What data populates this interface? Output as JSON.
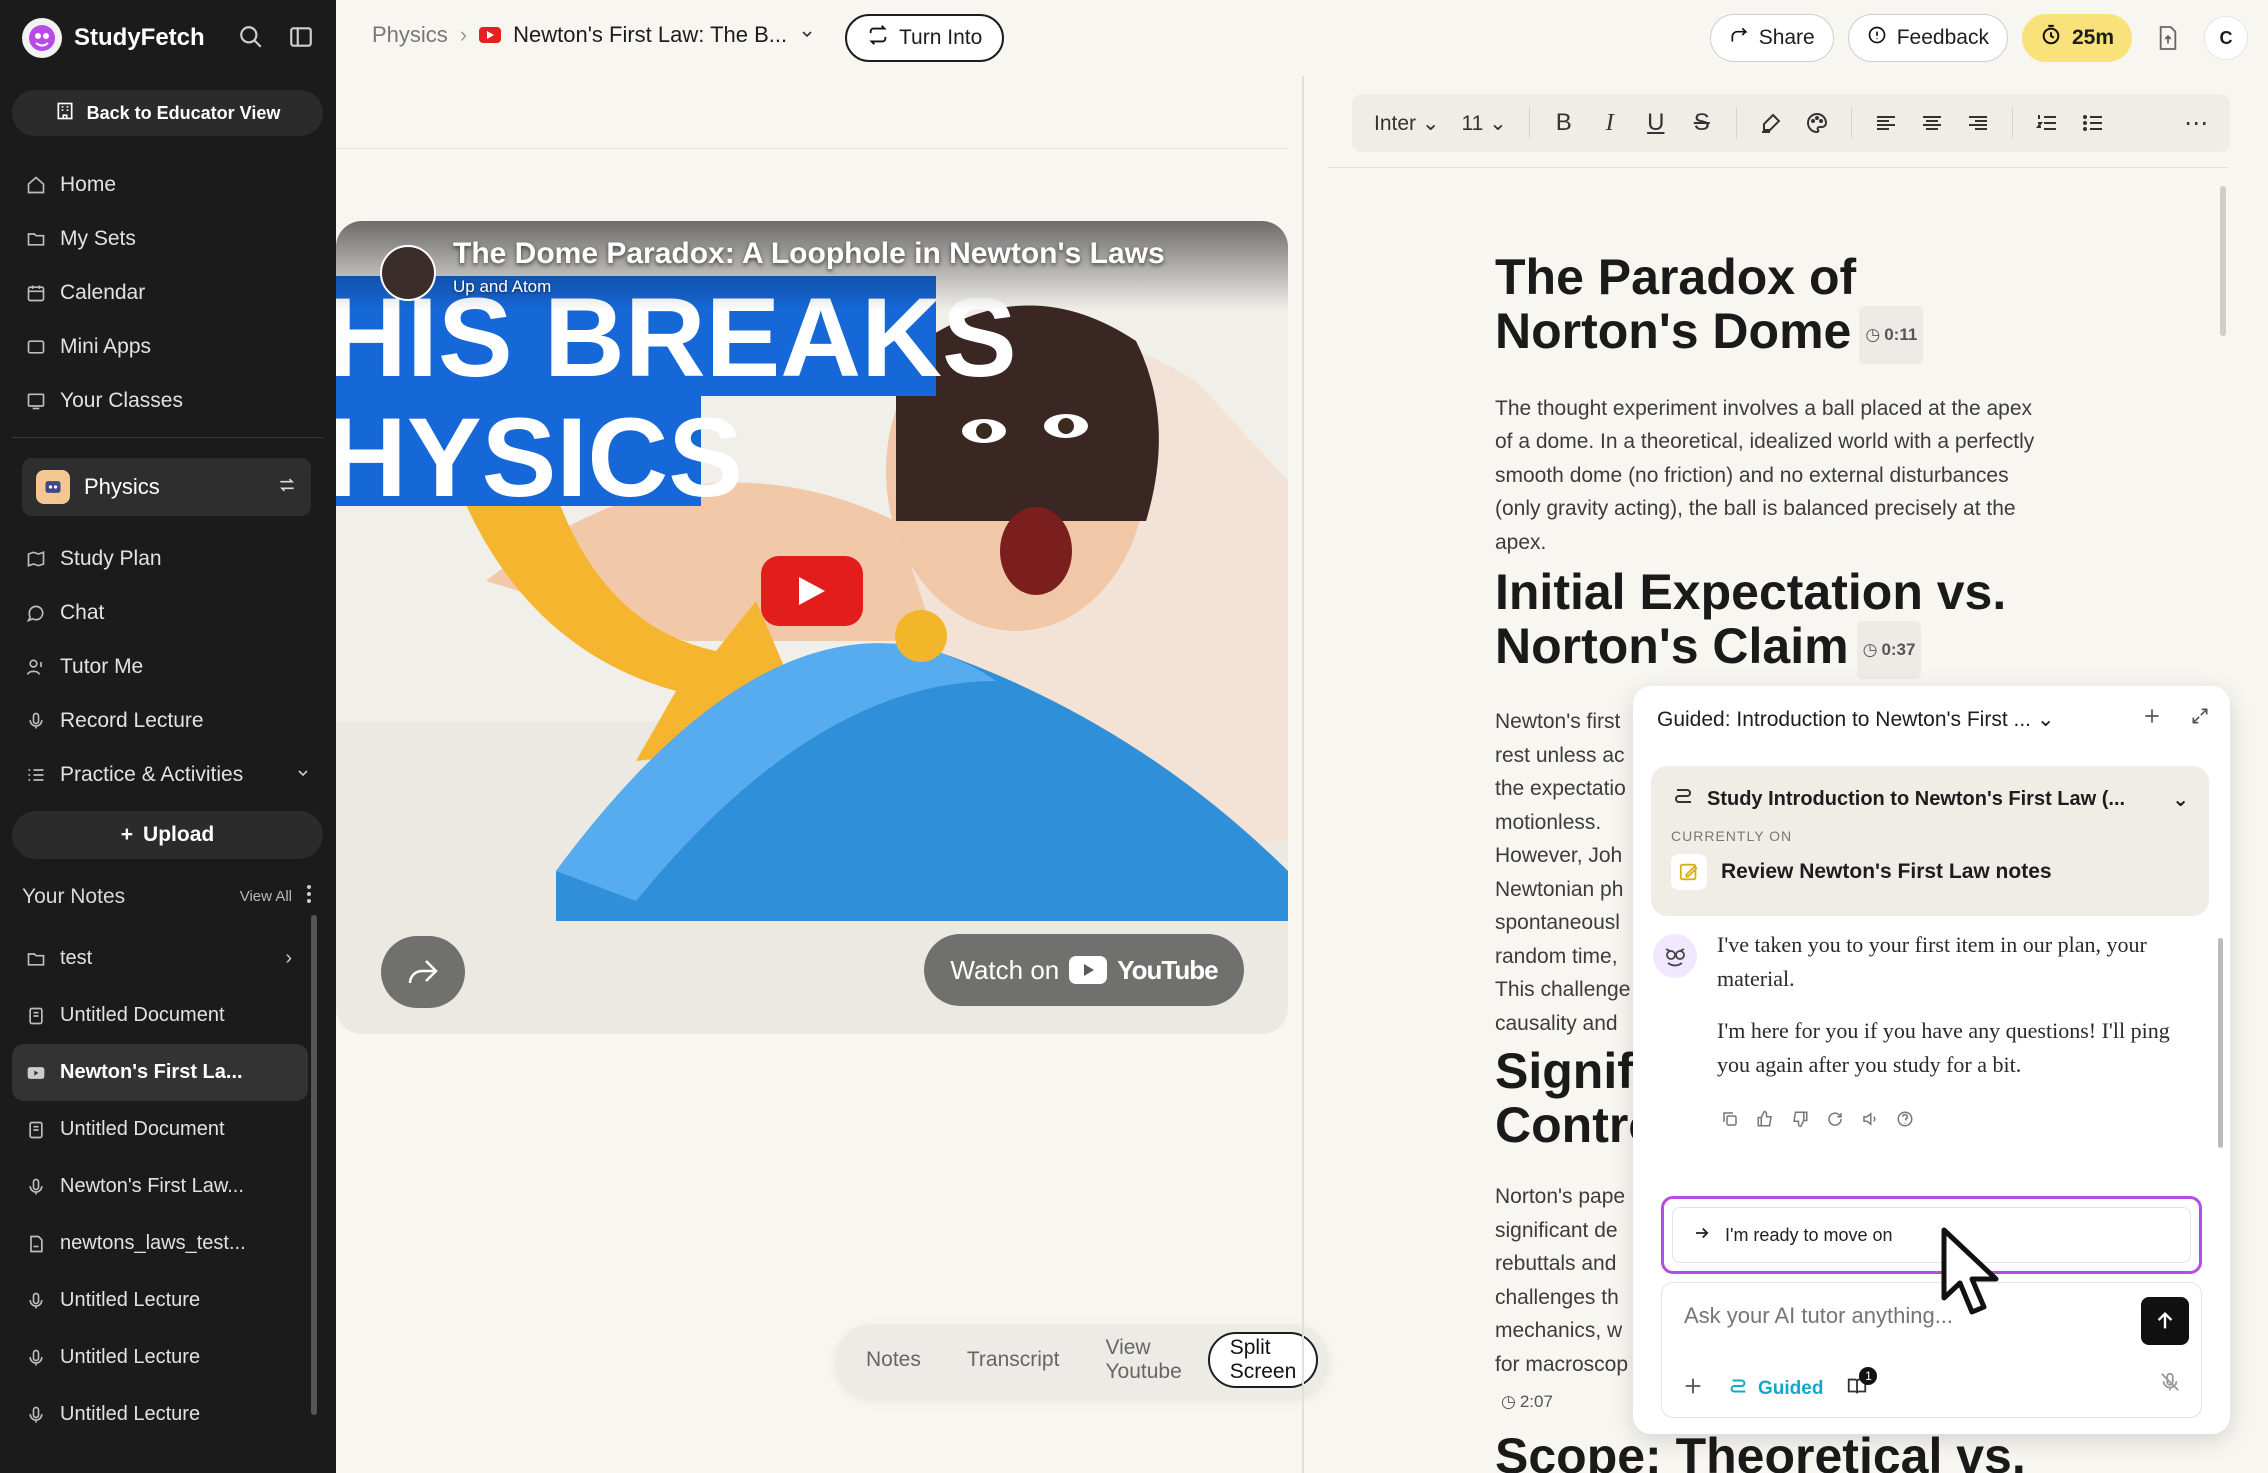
{
  "sidebar": {
    "brand": "StudyFetch",
    "educator_button": "Back to Educator View",
    "nav": [
      {
        "label": "Home",
        "icon": "home-icon"
      },
      {
        "label": "My Sets",
        "icon": "folder-icon"
      },
      {
        "label": "Calendar",
        "icon": "calendar-icon"
      },
      {
        "label": "Mini Apps",
        "icon": "apps-icon"
      },
      {
        "label": "Your Classes",
        "icon": "classes-icon"
      }
    ],
    "class_name": "Physics",
    "class_nav": [
      {
        "label": "Study Plan",
        "icon": "map-icon"
      },
      {
        "label": "Chat",
        "icon": "chat-icon"
      },
      {
        "label": "Tutor Me",
        "icon": "tutor-icon"
      },
      {
        "label": "Record Lecture",
        "icon": "mic-icon"
      },
      {
        "label": "Practice & Activities",
        "icon": "list-icon"
      }
    ],
    "upload_label": "Upload",
    "notes_title": "Your Notes",
    "notes_view_all": "View All",
    "notes": [
      {
        "label": "test",
        "icon": "folder-icon"
      },
      {
        "label": "Untitled Document",
        "icon": "document-icon"
      },
      {
        "label": "Newton's First La...",
        "icon": "video-icon"
      },
      {
        "label": "Untitled Document",
        "icon": "document-icon"
      },
      {
        "label": "Newton's First Law...",
        "icon": "mic-icon"
      },
      {
        "label": "newtons_laws_test...",
        "icon": "pdf-icon"
      },
      {
        "label": "Untitled Lecture",
        "icon": "mic-icon"
      },
      {
        "label": "Untitled Lecture",
        "icon": "mic-icon"
      },
      {
        "label": "Untitled Lecture",
        "icon": "mic-icon"
      }
    ]
  },
  "topbar": {
    "breadcrumb_root": "Physics",
    "breadcrumb_current": "Newton's First Law: The B...",
    "turn_into": "Turn Into",
    "share": "Share",
    "feedback": "Feedback",
    "timer": "25m",
    "avatar_letter": "C"
  },
  "video": {
    "title": "The Dome Paradox: A Loophole in Newton's Laws",
    "channel": "Up and Atom",
    "thumb_line1": "HIS BREAKS",
    "thumb_line2": "HYSICS",
    "watch_on": "Watch on",
    "youtube": "YouTube"
  },
  "view_tabs": [
    "Notes",
    "Transcript",
    "View Youtube",
    "Split Screen"
  ],
  "toolbar": {
    "font": "Inter",
    "size": "11"
  },
  "doc": {
    "h1": "The Paradox of Norton's Dome",
    "t1": "0:11",
    "p1": "The thought experiment involves a ball placed at the apex of a dome. In a theoretical, idealized world with a perfectly smooth dome (no friction) and no external disturbances (only gravity acting), the ball is balanced precisely at the apex.",
    "h2": "Initial Expectation vs. Norton's Claim",
    "t2": "0:37",
    "p2_lines": [
      "Newton's first",
      "rest unless ac",
      "the expectatio",
      "motionless.",
      "However, Joh",
      "Newtonian ph",
      "spontaneousl",
      "random time,",
      "This challenge",
      "causality and"
    ],
    "h3_lines": [
      "Signifi",
      "Contro"
    ],
    "p3_lines": [
      "Norton's pape",
      "significant de",
      "rebuttals and",
      "challenges th",
      "mechanics, w",
      "for macroscop"
    ],
    "t3": "2:07",
    "h4": "Scope: Theoretical vs."
  },
  "chat": {
    "title": "Guided: Introduction to Newton's First ...",
    "plan_title": "Study Introduction to Newton's First Law (...",
    "currently_on": "CURRENTLY ON",
    "current_item": "Review Newton's First Law notes",
    "msg1": "I've taken you to your first item in our plan, your material.",
    "msg2": "I'm here for you if you have any questions! I'll ping you again after you study for a bit.",
    "suggestion": "I'm ready to move on",
    "placeholder": "Ask your AI tutor anything...",
    "guided_label": "Guided",
    "badge_count": "1"
  }
}
